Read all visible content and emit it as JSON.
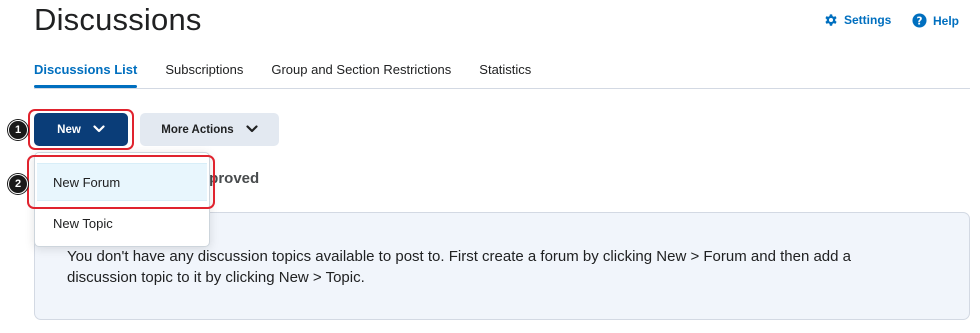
{
  "page": {
    "title": "Discussions"
  },
  "header_links": {
    "settings_label": "Settings",
    "help_label": "Help"
  },
  "tabs": [
    {
      "label": "Discussions List",
      "active": true
    },
    {
      "label": "Subscriptions"
    },
    {
      "label": "Group and Section Restrictions"
    },
    {
      "label": "Statistics"
    }
  ],
  "toolbar": {
    "new_label": "New",
    "more_actions_label": "More Actions"
  },
  "dropdown": {
    "items": [
      {
        "label": "New Forum"
      },
      {
        "label": "New Topic"
      }
    ]
  },
  "partial_heading": "pproved",
  "info_message": "You don't have any discussion topics available to post to. First create a forum by clicking New > Forum and then add a discussion topic to it by clicking New > Topic.",
  "annotations": {
    "step1": "1",
    "step2": "2"
  },
  "colors": {
    "brand_blue": "#006fbf",
    "primary_button": "#0a3d78",
    "highlight_red": "#e0232e"
  }
}
